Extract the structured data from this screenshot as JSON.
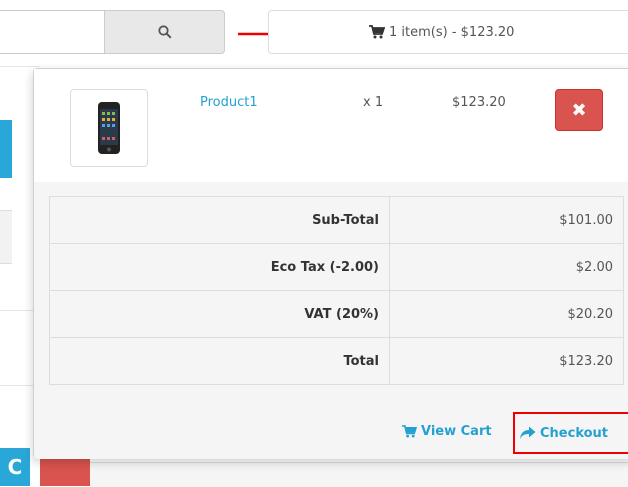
{
  "header": {
    "search_icon": "search-icon",
    "cart_summary": "1 item(s) - $123.20"
  },
  "cart": {
    "items": [
      {
        "name": "Product1",
        "qty": "x 1",
        "price": "$123.20",
        "remove_label": "✖"
      }
    ],
    "totals": [
      {
        "label": "Sub-Total",
        "value": "$101.00"
      },
      {
        "label": "Eco Tax (-2.00)",
        "value": "$2.00"
      },
      {
        "label": "VAT (20%)",
        "value": "$20.20"
      },
      {
        "label": "Total",
        "value": "$123.20"
      }
    ],
    "view_cart_label": "View Cart",
    "checkout_label": "Checkout"
  },
  "colors": {
    "link": "#23a1d1",
    "danger": "#d9534f",
    "annotation": "#e00000"
  }
}
